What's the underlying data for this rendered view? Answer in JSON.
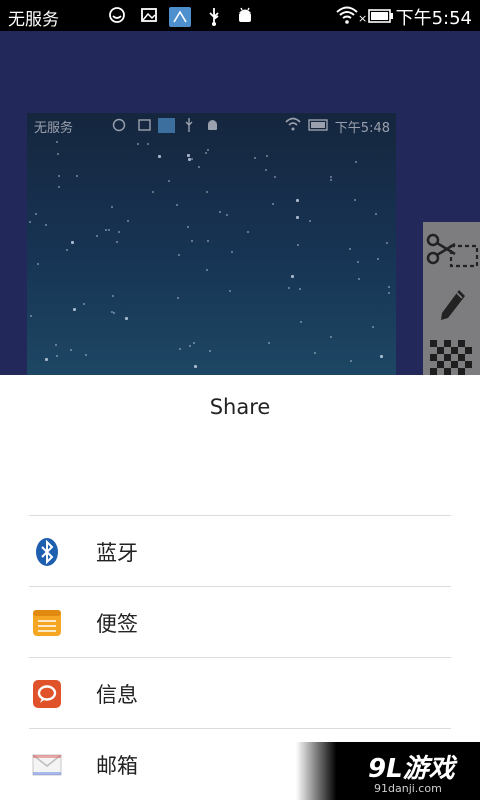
{
  "status_bar": {
    "carrier": "无服务",
    "time": "下午5:54"
  },
  "preview": {
    "carrier": "无服务",
    "time": "下午5:48"
  },
  "tools": [
    {
      "icon": "scissors-crop-icon"
    },
    {
      "icon": "pencil-icon"
    },
    {
      "icon": "mosaic-icon"
    }
  ],
  "share_sheet": {
    "title": "Share",
    "items": [
      {
        "label": "蓝牙",
        "icon": "bluetooth-icon"
      },
      {
        "label": "便签",
        "icon": "notes-icon"
      },
      {
        "label": "信息",
        "icon": "message-icon"
      },
      {
        "label": "邮箱",
        "icon": "mail-icon"
      }
    ]
  },
  "watermark": {
    "brand": "9L游戏",
    "url": "91danji.com"
  },
  "colors": {
    "backdrop": "#22285a",
    "bluetooth": "#1f5fb0",
    "notes": "#f5a623",
    "message": "#e0522a"
  }
}
